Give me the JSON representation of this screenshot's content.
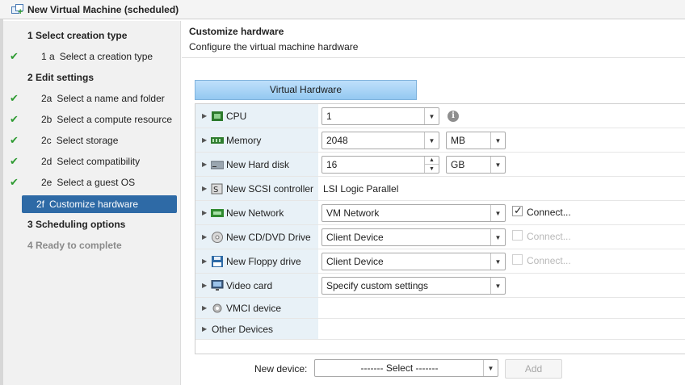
{
  "window": {
    "title": "New Virtual Machine (scheduled)"
  },
  "sidebar": {
    "steps": [
      {
        "type": "header",
        "label": "1  Select creation type",
        "state": "normal"
      },
      {
        "type": "sub",
        "code": "1 a",
        "label": "Select a creation type",
        "done": true
      },
      {
        "type": "header",
        "label": "2  Edit settings",
        "state": "normal"
      },
      {
        "type": "sub",
        "code": "2a",
        "label": "Select a name and folder",
        "done": true
      },
      {
        "type": "sub",
        "code": "2b",
        "label": "Select a compute resource",
        "done": true
      },
      {
        "type": "sub",
        "code": "2c",
        "label": "Select storage",
        "done": true
      },
      {
        "type": "sub",
        "code": "2d",
        "label": "Select compatibility",
        "done": true
      },
      {
        "type": "sub",
        "code": "2e",
        "label": "Select a guest OS",
        "done": true
      },
      {
        "type": "sub",
        "code": "2f",
        "label": "Customize hardware",
        "active": true
      },
      {
        "type": "header",
        "label": "3  Scheduling options",
        "state": "normal"
      },
      {
        "type": "header",
        "label": "4  Ready to complete",
        "state": "disabled"
      }
    ]
  },
  "main": {
    "title": "Customize hardware",
    "subtitle": "Configure the virtual machine hardware",
    "tab_label": "Virtual Hardware",
    "hardware": {
      "cpu": {
        "label": "CPU",
        "value": "1"
      },
      "memory": {
        "label": "Memory",
        "value": "2048",
        "unit": "MB"
      },
      "hard_disk": {
        "label": "New Hard disk",
        "value": "16",
        "unit": "GB"
      },
      "scsi": {
        "label": "New SCSI controller",
        "value": "LSI Logic Parallel"
      },
      "network": {
        "label": "New Network",
        "value": "VM Network",
        "connect_label": "Connect...",
        "connected": true
      },
      "cd_dvd": {
        "label": "New CD/DVD Drive",
        "value": "Client Device",
        "connect_label": "Connect...",
        "connected": false
      },
      "floppy": {
        "label": "New Floppy drive",
        "value": "Client Device",
        "connect_label": "Connect...",
        "connected": false
      },
      "video": {
        "label": "Video card",
        "value": "Specify custom settings"
      },
      "vmci": {
        "label": "VMCI device"
      },
      "other": {
        "label": "Other Devices"
      }
    },
    "new_device": {
      "label": "New device:",
      "value": "------- Select -------",
      "add_label": "Add"
    }
  },
  "colors": {
    "active_step_bg": "#2e6aa6",
    "check_green": "#2e9b32",
    "tab_blue": "#94c8f1",
    "label_column_bg": "#e8f1f7"
  }
}
